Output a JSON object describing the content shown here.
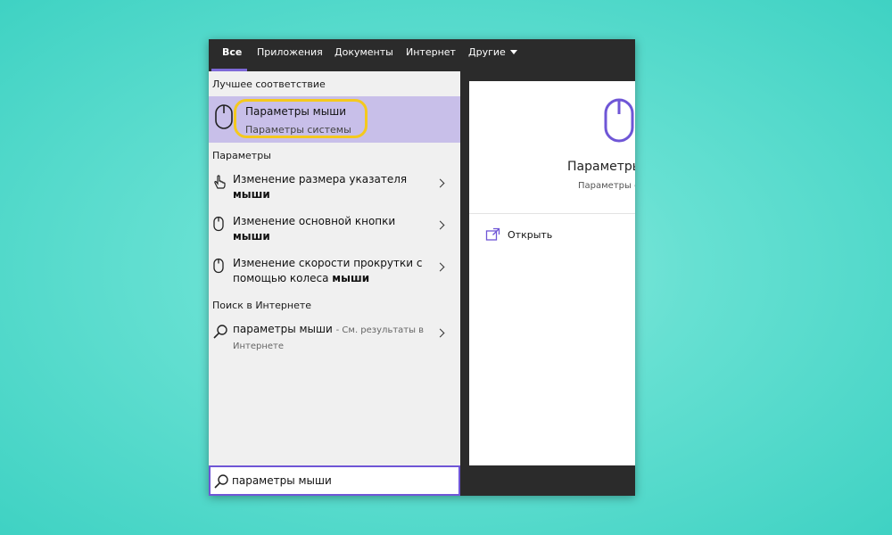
{
  "tabs": [
    {
      "label": "Все",
      "active": true
    },
    {
      "label": "Приложения",
      "active": false
    },
    {
      "label": "Документы",
      "active": false
    },
    {
      "label": "Интернет",
      "active": false
    },
    {
      "label": "Другие",
      "active": false
    }
  ],
  "best_match": {
    "header": "Лучшее соответствие",
    "title": "Параметры мыши",
    "subtitle": "Параметры системы",
    "icon": "mouse-icon"
  },
  "settings": {
    "header": "Параметры",
    "items": [
      {
        "text": "Изменение размера указателя",
        "bold": "мыши",
        "icon": "pointer-hand-icon"
      },
      {
        "text": "Изменение основной кнопки",
        "bold": "мыши",
        "icon": "mouse-icon"
      },
      {
        "text": "Изменение скорости прокрутки с помощью колеса",
        "bold": "мыши",
        "icon": "mouse-icon"
      }
    ]
  },
  "web": {
    "header": "Поиск в Интернете",
    "query": "параметры мыши",
    "hint": "- См. результаты в Интернете",
    "icon": "search-icon"
  },
  "preview": {
    "title": "Параметры",
    "subtitle": "Параметры с",
    "open_label": "Открыть",
    "icon": "mouse-icon"
  },
  "search": {
    "value": "параметры мыши",
    "icon": "search-icon"
  },
  "colors": {
    "accent": "#6f56d6",
    "highlight_ring": "#f4c91d",
    "selected_bg": "#c8bfe9",
    "taskbar": "#2b2b2b"
  }
}
